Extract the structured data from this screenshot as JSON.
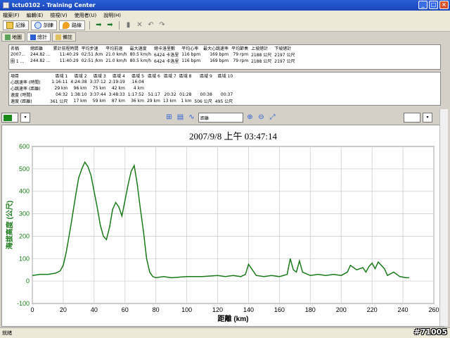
{
  "window": {
    "title": "tctu0102 - Training Center"
  },
  "menu": [
    "檔案(F)",
    "編輯(E)",
    "檢視(V)",
    "使用者(U)",
    "說明(H)"
  ],
  "toolbar": {
    "record": "記錄",
    "train": "訓練",
    "route": "路線"
  },
  "tabs": [
    "地圖",
    "總計",
    "備註"
  ],
  "summary": {
    "headers": [
      "名稱",
      "總距離",
      "累計前程時間",
      "平均步速",
      "平均前速",
      "最大速度",
      "總卡洛里數",
      "平均心率",
      "最大心跳速率",
      "平均節奏",
      "上坡總計",
      "下坡總計"
    ],
    "rows": [
      [
        "2007...",
        "244.82 ...",
        "11:40:29",
        "02:51 /km",
        "21.0 km/h",
        "80.5 km/h",
        "6424 卡洛里",
        "116 bpm",
        "169 bpm",
        "79 rpm",
        "2188 公尺",
        "2197 公尺"
      ],
      [
        "圈 1 ...",
        "244.82 ...",
        "11:40:29",
        "02:51 /km",
        "21.0 km/h",
        "80.5 km/h",
        "6424 卡洛里",
        "116 bpm",
        "169 bpm",
        "79 rpm",
        "2188 公尺",
        "2197 公尺"
      ]
    ]
  },
  "laps": {
    "headers": [
      "項目",
      "區域 1",
      "區域 2",
      "區域 3",
      "區域 4",
      "區域 5",
      "區域 6",
      "區域 7",
      "區域 8",
      "區域 9",
      "區域 10"
    ],
    "rows": [
      [
        "心跳速率 (時間)",
        "1:16:11",
        "4:24:38",
        "3:37:12",
        "2:19:19",
        "16:04",
        "",
        "",
        "",
        "",
        ""
      ],
      [
        "心跳速率 (距離)",
        "29 km",
        "96 km",
        "75 km",
        "42 km",
        "4 km",
        "",
        "",
        "",
        "",
        ""
      ],
      [
        "速度 (時間)",
        "04:32",
        "1:38:10",
        "3:37:44",
        "3:48:33",
        "1:17:52",
        "51:17",
        "20:32",
        "01:28",
        "00:38",
        "00:37"
      ],
      [
        "速度 (距離)",
        "361 公尺",
        "17 km",
        "59 km",
        "87 km",
        "36 km",
        "29 km",
        "13 km",
        "1 km",
        "506 公尺",
        "495 公尺"
      ]
    ]
  },
  "chart_controls": {
    "mode": "距離"
  },
  "status": "就緒",
  "watermark": "#71005",
  "chart_data": {
    "type": "line",
    "title": "2007/9/8 上午 03:47:14",
    "xlabel": "距離 (km)",
    "ylabel": "海拔高度 (公尺)",
    "xlim": [
      0,
      260
    ],
    "ylim": [
      -100,
      600
    ],
    "xticks": [
      0,
      20,
      40,
      60,
      80,
      100,
      120,
      140,
      160,
      180,
      200,
      220,
      240,
      260
    ],
    "yticks": [
      -100,
      0,
      100,
      200,
      300,
      400,
      500,
      600
    ],
    "grid": true,
    "color": "#1a7a1a",
    "series": [
      {
        "x": [
          0,
          5,
          10,
          15,
          18,
          20,
          22,
          25,
          28,
          30,
          32,
          34,
          36,
          38,
          40,
          42,
          44,
          46,
          48,
          50,
          52,
          54,
          56,
          58,
          60,
          62,
          64,
          66,
          68,
          70,
          72,
          74,
          76,
          78,
          80,
          85,
          90,
          100,
          110,
          120,
          125,
          130,
          135,
          138,
          140,
          145,
          150,
          155,
          160,
          165,
          167,
          169,
          171,
          173,
          175,
          180,
          185,
          190,
          195,
          200,
          204,
          206,
          210,
          214,
          216,
          218,
          220,
          222,
          224,
          226,
          228,
          230,
          234,
          238,
          242,
          244
        ],
        "y": [
          25,
          30,
          30,
          35,
          45,
          70,
          130,
          250,
          380,
          460,
          500,
          530,
          510,
          470,
          400,
          330,
          250,
          200,
          185,
          240,
          320,
          350,
          330,
          290,
          360,
          430,
          490,
          515,
          430,
          320,
          220,
          100,
          40,
          20,
          15,
          20,
          15,
          20,
          20,
          25,
          20,
          25,
          20,
          30,
          75,
          25,
          20,
          25,
          20,
          30,
          100,
          50,
          40,
          90,
          40,
          25,
          30,
          25,
          30,
          25,
          40,
          70,
          50,
          60,
          40,
          65,
          80,
          55,
          85,
          70,
          55,
          25,
          40,
          20,
          15,
          15
        ]
      }
    ]
  }
}
